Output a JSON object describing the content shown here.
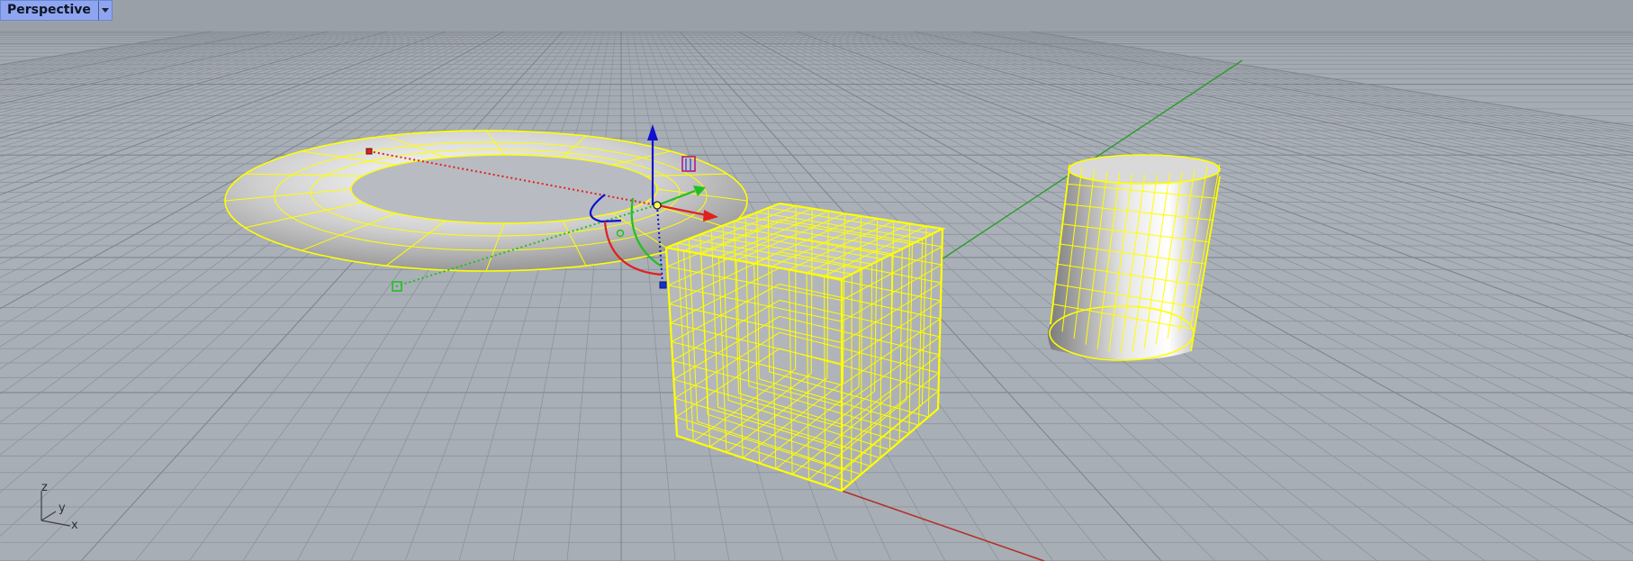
{
  "viewport": {
    "title": "Perspective",
    "menu_icon": "chevron-down-icon"
  },
  "axis_triad": {
    "z": "z",
    "y": "y",
    "x": "x"
  },
  "scene": {
    "objects": [
      "torus",
      "box",
      "cylinder"
    ],
    "selection_color": "#ffff00",
    "world_axis_x_color": "#b03028",
    "world_axis_y_color": "#2f9a2f"
  },
  "gumball": {
    "x_color": "#e02020",
    "y_color": "#20c020",
    "z_color": "#1010d0"
  }
}
